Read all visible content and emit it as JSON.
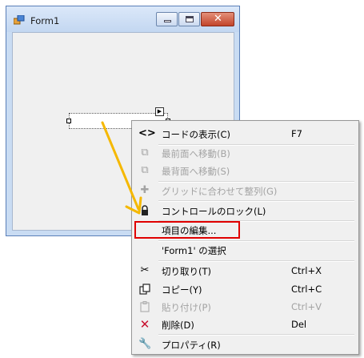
{
  "form": {
    "title": "Form1"
  },
  "context_menu": {
    "items": [
      {
        "label": "コードの表示(C)",
        "shortcut": "F7",
        "icon": "code-icon",
        "enabled": true
      },
      {
        "label": "最前面へ移動(B)",
        "shortcut": "",
        "icon": "bring-to-front-icon",
        "enabled": false
      },
      {
        "label": "最背面へ移動(S)",
        "shortcut": "",
        "icon": "send-to-back-icon",
        "enabled": false
      },
      {
        "label": "グリッドに合わせて整列(G)",
        "shortcut": "",
        "icon": "align-to-grid-icon",
        "enabled": false
      },
      {
        "label": "コントロールのロック(L)",
        "shortcut": "",
        "icon": "lock-icon",
        "enabled": true
      },
      {
        "label": "項目の編集...",
        "shortcut": "",
        "icon": "",
        "enabled": true
      },
      {
        "label": "'Form1' の選択",
        "shortcut": "",
        "icon": "",
        "enabled": true
      },
      {
        "label": "切り取り(T)",
        "shortcut": "Ctrl+X",
        "icon": "cut-icon",
        "enabled": true
      },
      {
        "label": "コピー(Y)",
        "shortcut": "Ctrl+C",
        "icon": "copy-icon",
        "enabled": true
      },
      {
        "label": "貼り付け(P)",
        "shortcut": "Ctrl+V",
        "icon": "paste-icon",
        "enabled": false
      },
      {
        "label": "削除(D)",
        "shortcut": "Del",
        "icon": "delete-icon",
        "enabled": true
      },
      {
        "label": "プロパティ(R)",
        "shortcut": "",
        "icon": "properties-icon",
        "enabled": true
      }
    ]
  },
  "colors": {
    "highlight_border": "#e00000",
    "arrow": "#f5b800",
    "delete_icon": "#c8102e",
    "disabled_text": "#a3a3a3"
  }
}
